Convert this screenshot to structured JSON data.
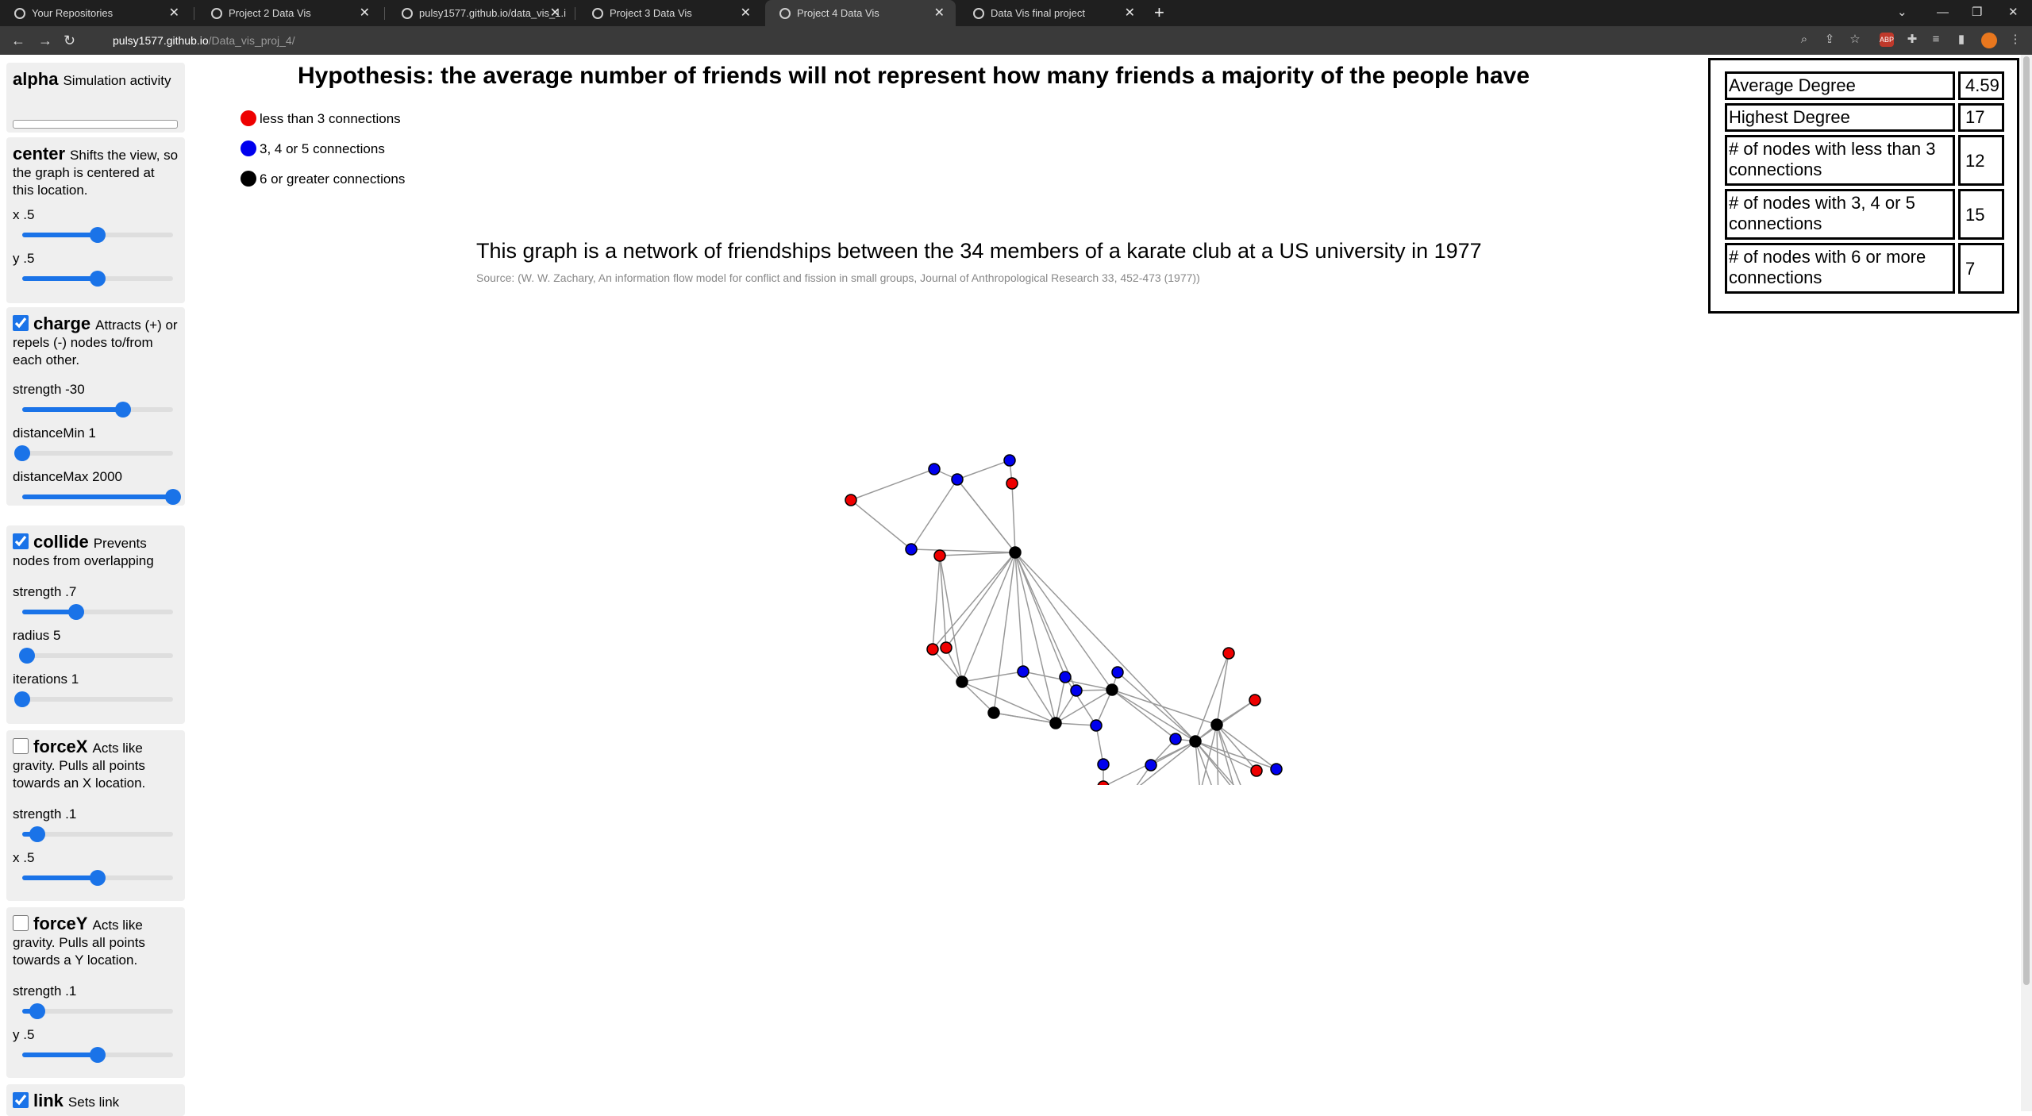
{
  "browser": {
    "tabs": [
      {
        "title": "Your Repositories",
        "active": false
      },
      {
        "title": "Project 2 Data Vis",
        "active": false
      },
      {
        "title": "pulsy1577.github.io/data_vis_1.i",
        "active": false
      },
      {
        "title": "Project 3 Data Vis",
        "active": false
      },
      {
        "title": "Project 4 Data Vis",
        "active": true
      },
      {
        "title": "Data Vis final project",
        "active": false
      }
    ],
    "url_host": "pulsy1577.github.io",
    "url_path": "/Data_vis_proj_4/"
  },
  "controls": {
    "alpha": {
      "name": "alpha",
      "desc": "Simulation activity",
      "progress": 0
    },
    "center": {
      "name": "center",
      "desc": "Shifts the view, so the graph is centered at this location.",
      "x_label": "x .5",
      "x_value": 0.5,
      "y_label": "y .5",
      "y_value": 0.5
    },
    "charge": {
      "name": "charge",
      "desc": "Attracts (+) or repels (-) nodes to/from each other.",
      "checked": true,
      "strength_label": "strength -30",
      "strength_pos": 0.67,
      "distmin_label": "distanceMin 1",
      "distmin_pos": 0.0,
      "distmax_label": "distanceMax 2000",
      "distmax_pos": 1.0
    },
    "collide": {
      "name": "collide",
      "desc": "Prevents nodes from overlapping",
      "checked": true,
      "strength_label": "strength .7",
      "strength_pos": 0.36,
      "radius_label": "radius 5",
      "radius_pos": 0.03,
      "iterations_label": "iterations 1",
      "iterations_pos": 0.0
    },
    "forceX": {
      "name": "forceX",
      "desc": "Acts like gravity. Pulls all points towards an X location.",
      "checked": false,
      "strength_label": "strength .1",
      "strength_pos": 0.1,
      "x_label": "x .5",
      "x_pos": 0.5
    },
    "forceY": {
      "name": "forceY",
      "desc": "Acts like gravity. Pulls all points towards a Y location.",
      "checked": false,
      "strength_label": "strength .1",
      "strength_pos": 0.1,
      "y_label": "y .5",
      "y_pos": 0.5
    },
    "link": {
      "name": "link",
      "desc": "Sets link",
      "checked": true
    }
  },
  "hypothesis": "Hypothesis: the average number of friends will not represent how many friends a majority of the people have",
  "legend": [
    {
      "label": "less than 3 connections",
      "color": "#ee0000"
    },
    {
      "label": "3, 4 or 5 connections",
      "color": "#0000ee"
    },
    {
      "label": "6 or greater connections",
      "color": "#000000"
    }
  ],
  "graph": {
    "title": "This graph is a network of friendships between the 34 members of a karate club at a US university in 1977",
    "source": "Source: (W. W. Zachary, An information flow model for conflict and fission in small groups, Journal of Anthropological Research 33, 452-473 (1977))"
  },
  "stats": [
    {
      "label": "Average Degree",
      "value": "4.59"
    },
    {
      "label": "Highest Degree",
      "value": "17"
    },
    {
      "label": "# of nodes with less than 3 connections",
      "value": "12"
    },
    {
      "label": "# of nodes with 3, 4 or 5 connections",
      "value": "15"
    },
    {
      "label": "# of nodes with 6 or more connections",
      "value": "7"
    }
  ],
  "colors": {
    "low": "#ee0000",
    "mid": "#0000ee",
    "high": "#000000",
    "link": "#999999",
    "accent": "#1a73e8"
  }
}
